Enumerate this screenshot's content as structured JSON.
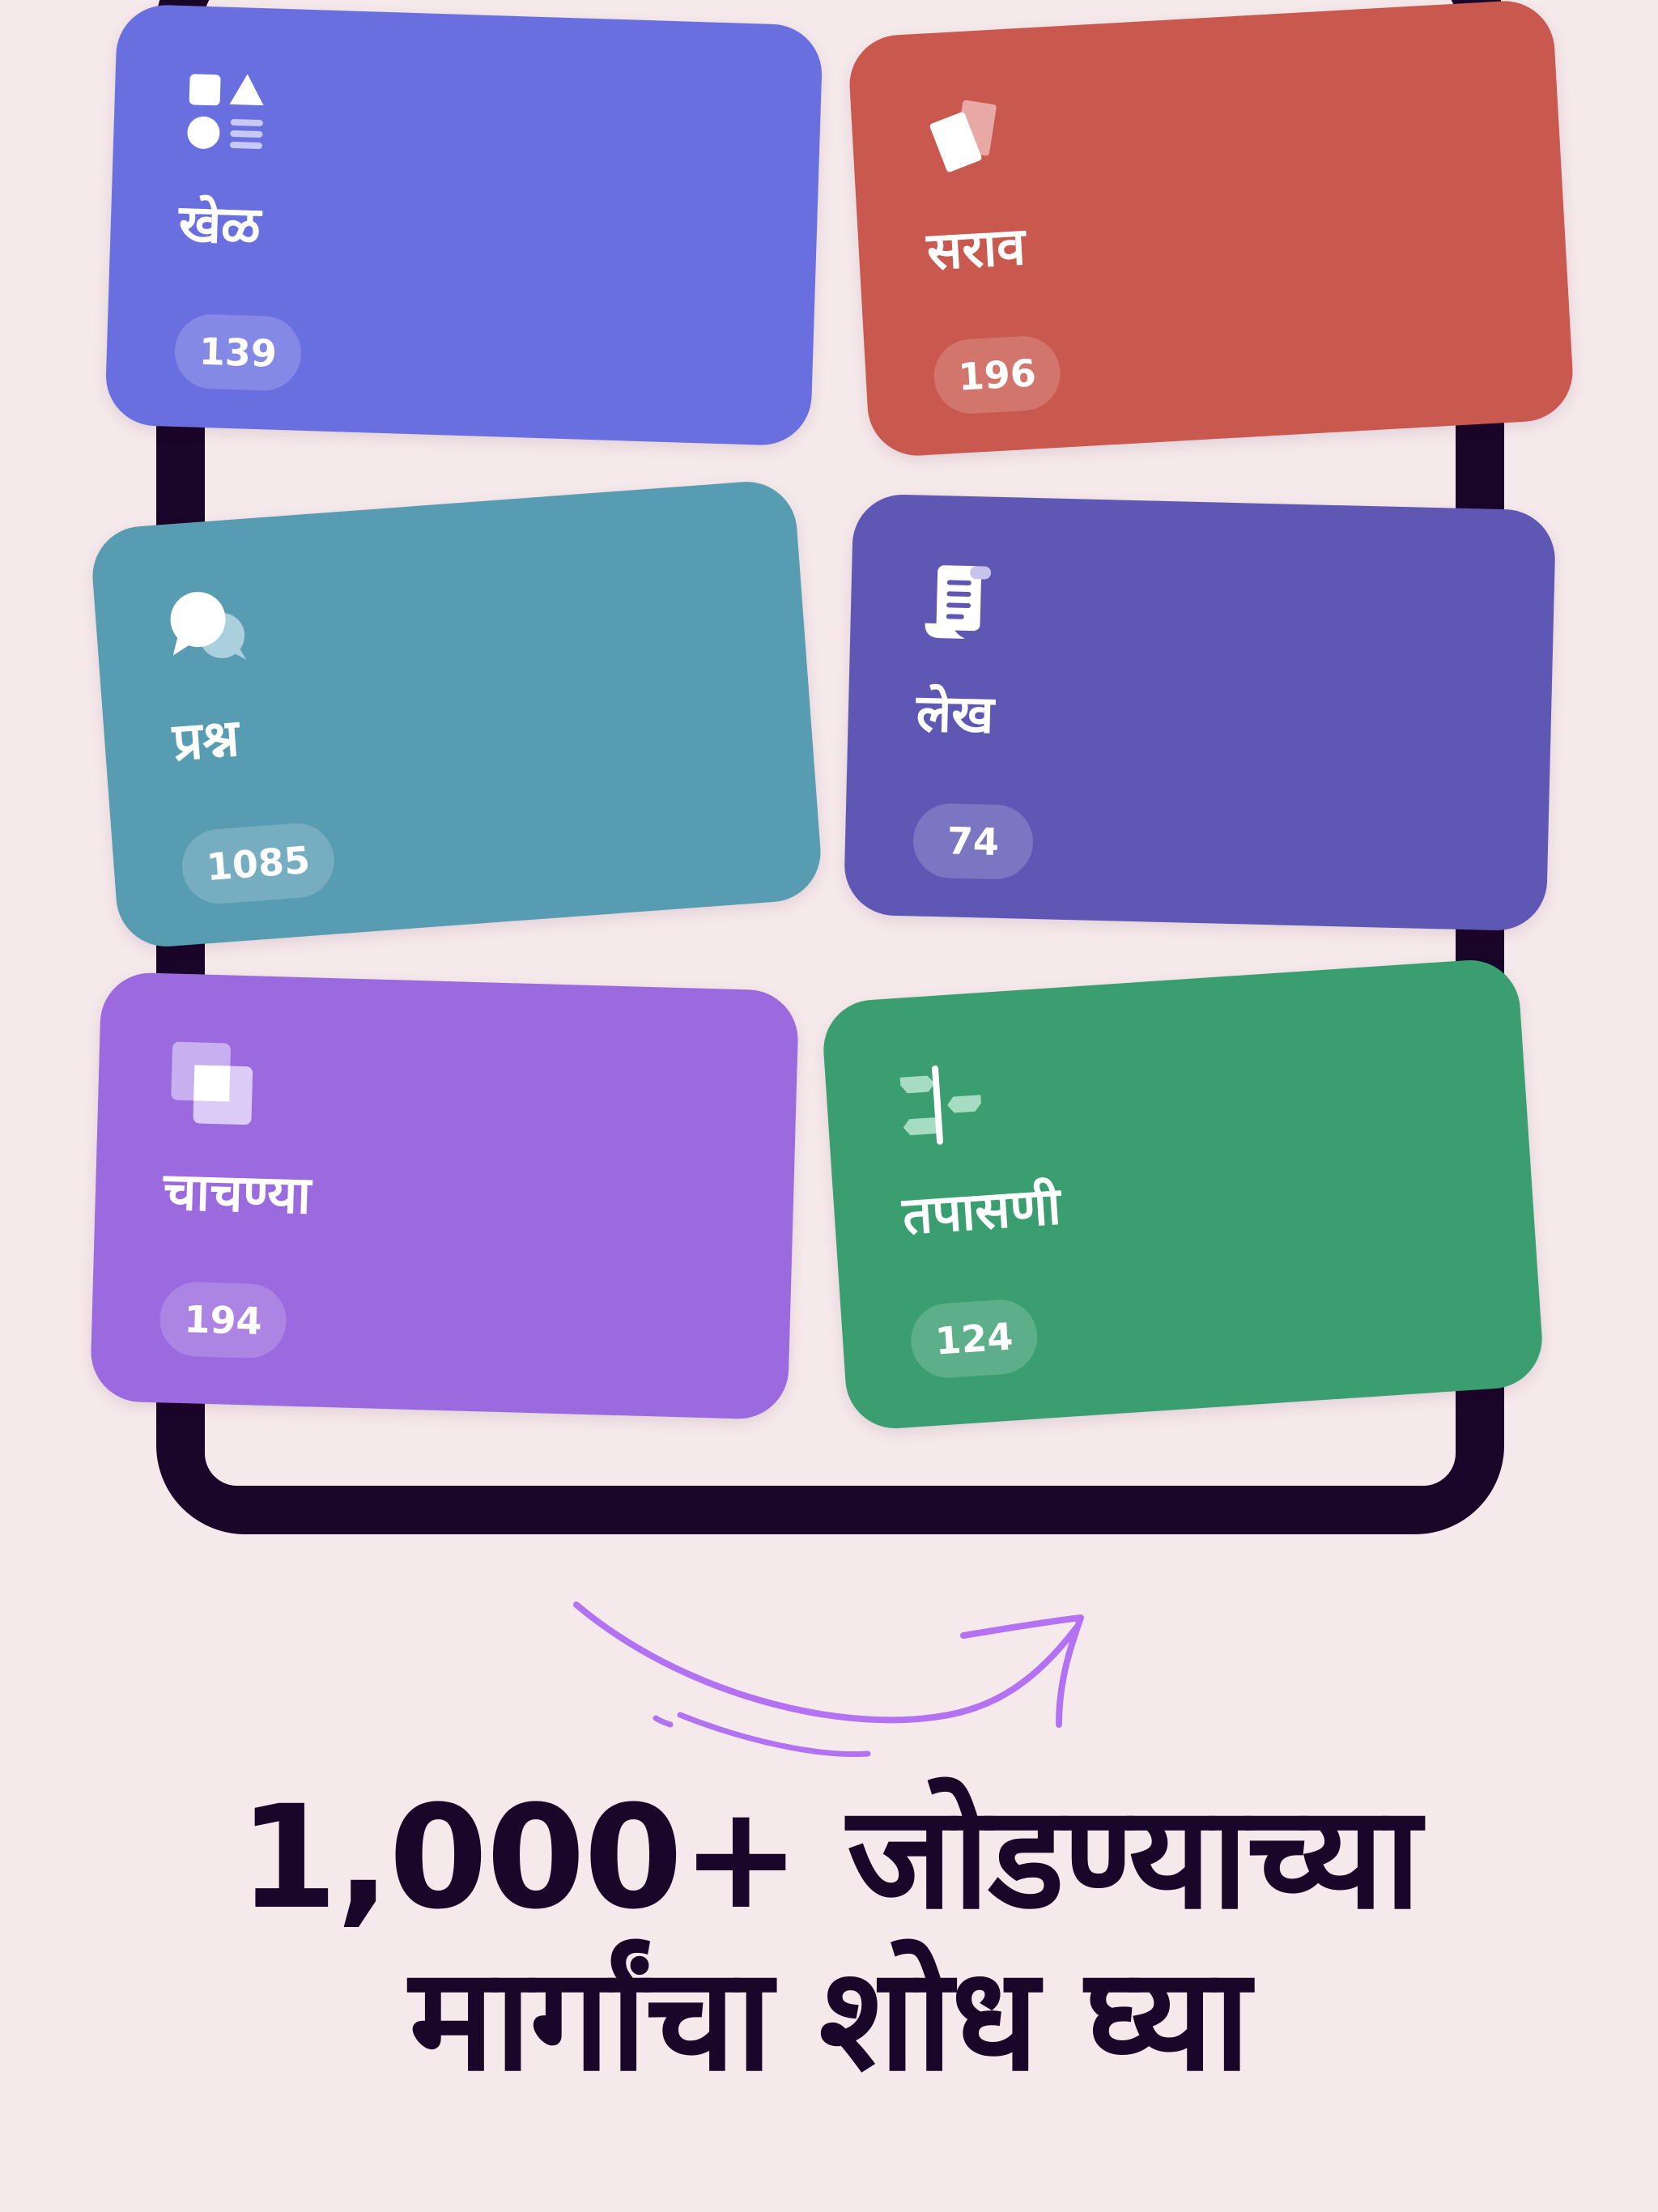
{
  "colors": {
    "background": "#F6E9EB",
    "device_frame": "#1A0628",
    "headline_text": "#1A0628",
    "arrow": "#B272F2"
  },
  "cards": [
    {
      "name": "games",
      "label": "खेळ",
      "count": "139",
      "color": "#6A6FE0",
      "icon": "shapes-icon"
    },
    {
      "name": "practice",
      "label": "सराव",
      "count": "196",
      "color": "#C9584E",
      "icon": "cards-icon"
    },
    {
      "name": "questions",
      "label": "प्रश्न",
      "count": "1085",
      "color": "#589CB2",
      "icon": "chat-bubbles-icon"
    },
    {
      "name": "articles",
      "label": "लेख",
      "count": "74",
      "color": "#5E58B4",
      "icon": "document-scroll-icon"
    },
    {
      "name": "tests",
      "label": "चाचण्या",
      "count": "194",
      "color": "#9A6ADE",
      "icon": "layered-squares-icon"
    },
    {
      "name": "checks",
      "label": "तपासणी",
      "count": "124",
      "color": "#3A9E70",
      "icon": "signpost-icon"
    }
  ],
  "headline": {
    "line1": "1,000+ जोडण्याच्या",
    "line2": "मार्गांचा शोध घ्या"
  }
}
